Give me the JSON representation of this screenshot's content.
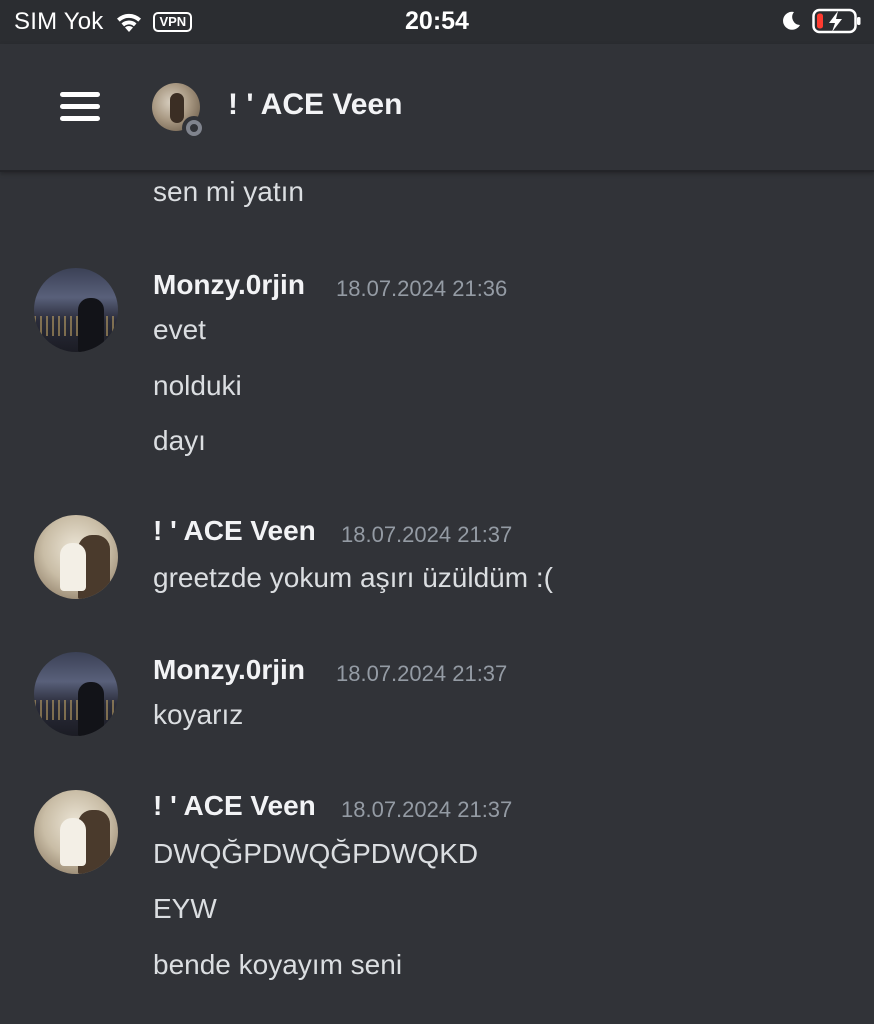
{
  "status_bar": {
    "carrier": "SIM Yok",
    "vpn": "VPN",
    "time": "20:54",
    "icons": [
      "wifi-icon",
      "moon-icon",
      "battery-charging-icon"
    ]
  },
  "header": {
    "title": "! ' ACE Veen",
    "icons": [
      "hamburger-menu-icon",
      "avatar",
      "status-idle-icon"
    ]
  },
  "messages": {
    "leading": "sen mi yatın",
    "groups": [
      {
        "author": "Monzy.0rjin",
        "timestamp": "18.07.2024 21:36",
        "lines": [
          "evet",
          "nolduki",
          "dayı"
        ]
      },
      {
        "author": "! ' ACE Veen",
        "timestamp": "18.07.2024 21:37",
        "lines": [
          "greetzde yokum aşırı üzüldüm :("
        ]
      },
      {
        "author": "Monzy.0rjin",
        "timestamp": "18.07.2024 21:37",
        "lines": [
          "koyarız"
        ]
      },
      {
        "author": "! ' ACE Veen",
        "timestamp": "18.07.2024 21:37",
        "lines": [
          "DWQĞPDWQĞPDWQKD",
          "EYW",
          "bende koyayım seni"
        ]
      }
    ]
  },
  "colors": {
    "background": "#313338",
    "header_bar": "#2b2d31",
    "text": "#dbdee1",
    "author": "#f2f3f5",
    "timestamp": "#949ba4"
  }
}
